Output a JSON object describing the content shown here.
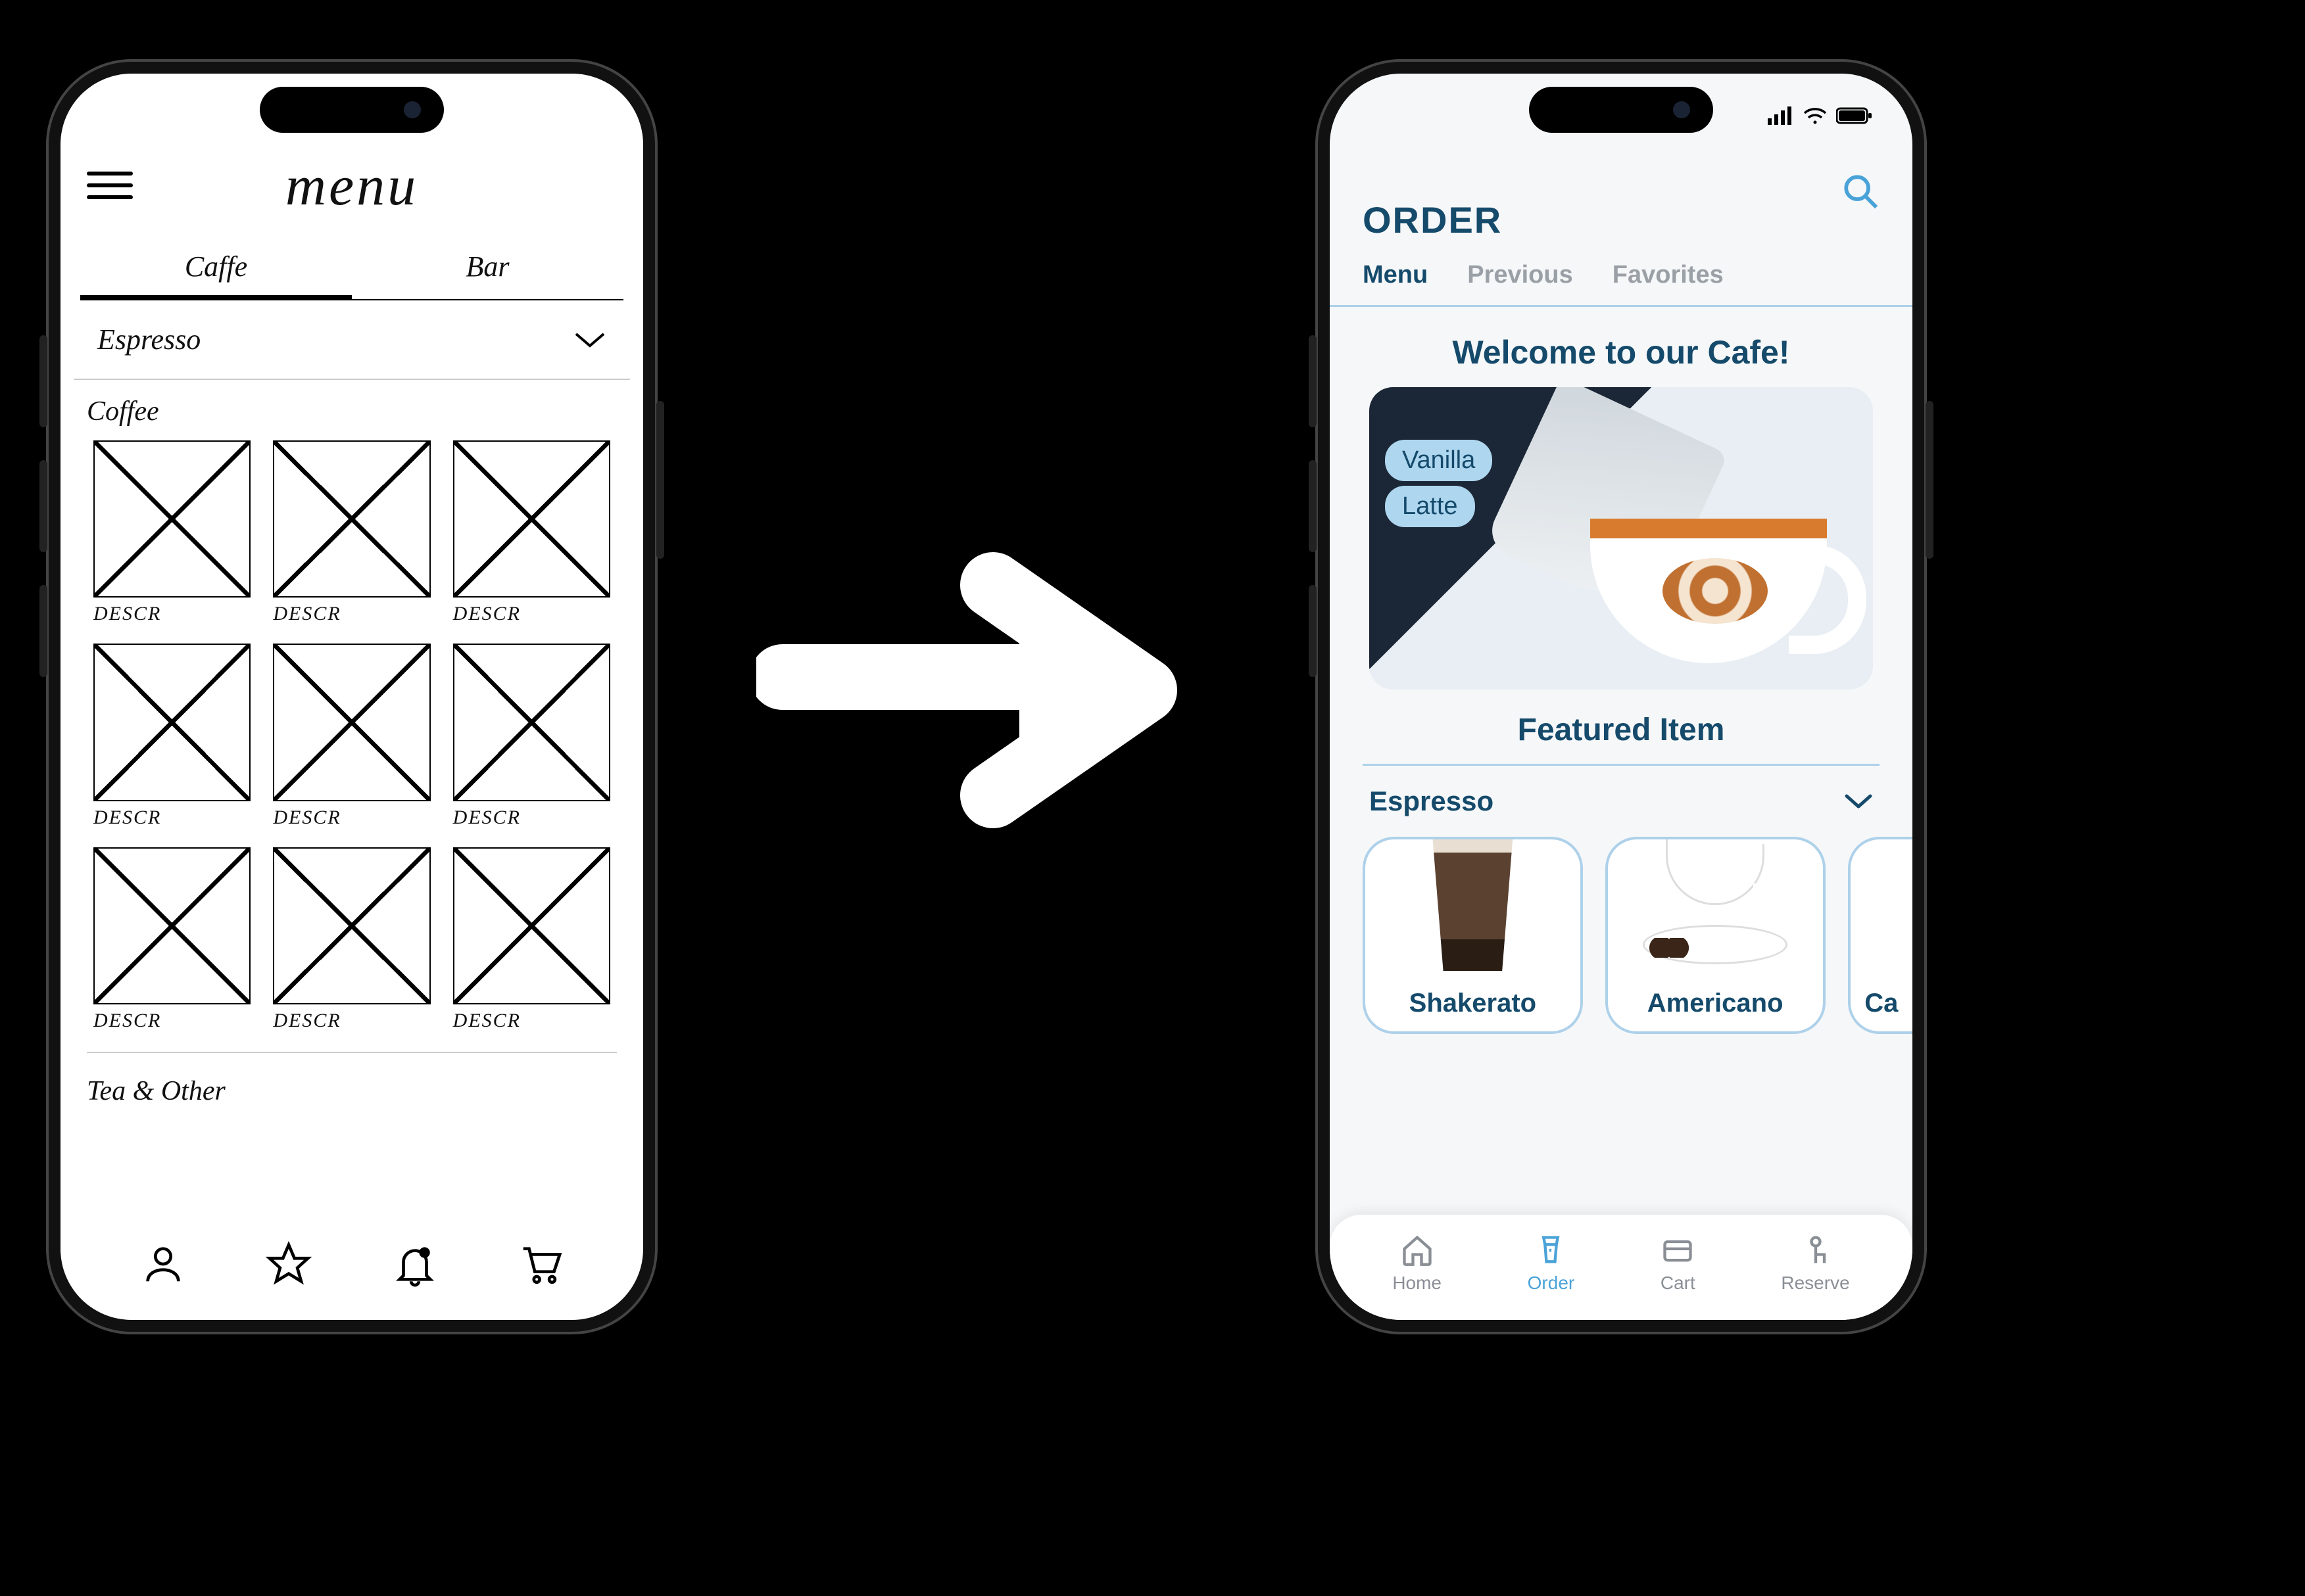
{
  "wireframe": {
    "title": "menu",
    "tabs": [
      "Caffe",
      "Bar"
    ],
    "active_tab_index": 0,
    "accordion_label": "Espresso",
    "sections": [
      {
        "title": "Coffee",
        "item_labels": [
          "DESCR",
          "DESCR",
          "DESCR",
          "DESCR",
          "DESCR",
          "DESCR",
          "DESCR",
          "DESCR",
          "DESCR"
        ]
      },
      {
        "title": "Tea & Other"
      }
    ],
    "bottom_icons": [
      "user",
      "star",
      "bell",
      "cart"
    ]
  },
  "hifi": {
    "page_title": "ORDER",
    "subtabs": [
      "Menu",
      "Previous",
      "Favorites"
    ],
    "active_subtab_index": 0,
    "welcome": "Welcome to our Cafe!",
    "hero_chips": [
      "Vanilla",
      "Latte"
    ],
    "featured_label": "Featured Item",
    "category": {
      "label": "Espresso"
    },
    "cards": [
      {
        "label": "Shakerato"
      },
      {
        "label": "Americano"
      },
      {
        "label": "Ca"
      }
    ],
    "nav": [
      {
        "label": "Home",
        "icon": "home"
      },
      {
        "label": "Order",
        "icon": "cup"
      },
      {
        "label": "Cart",
        "icon": "card"
      },
      {
        "label": "Reserve",
        "icon": "reserve"
      }
    ],
    "active_nav_index": 1,
    "colors": {
      "brand": "#154a6b",
      "accent": "#4aa3d8",
      "rule": "#aed1ea"
    }
  }
}
